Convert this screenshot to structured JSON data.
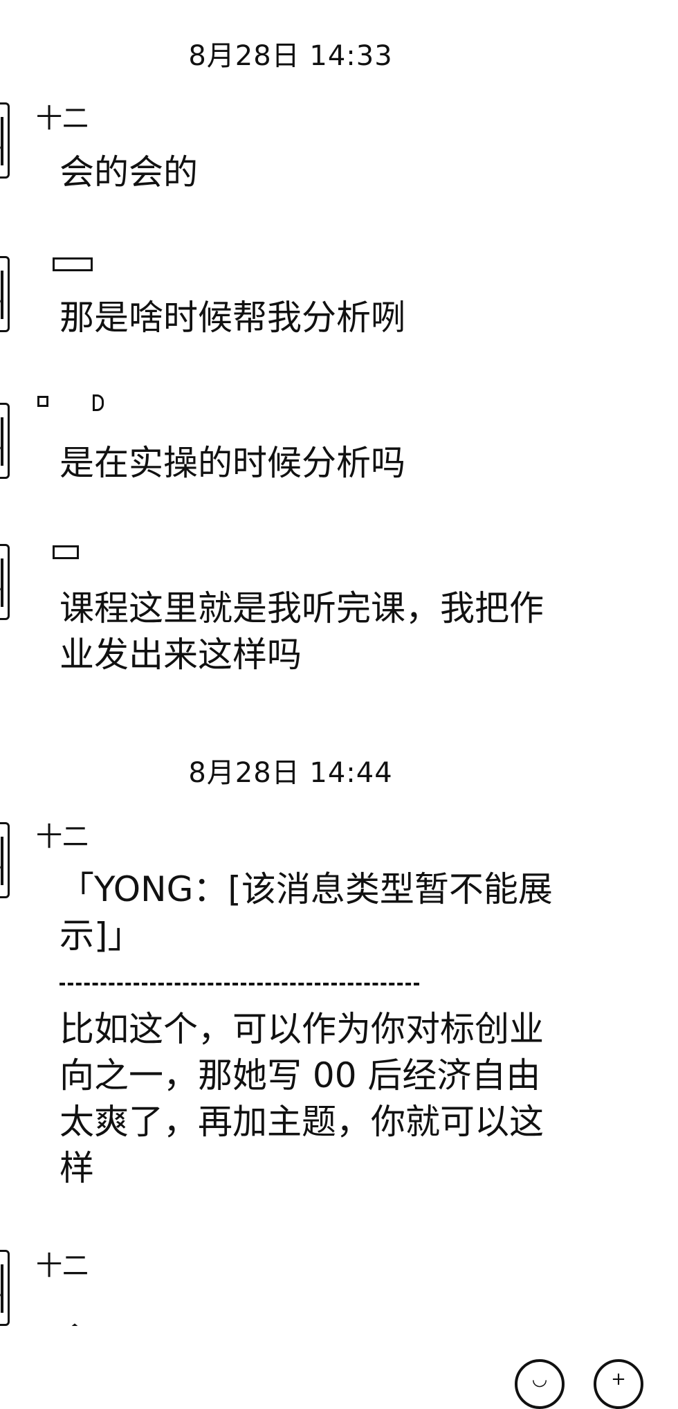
{
  "timestamps": [
    "8月28日 14:33",
    "8月28日 14:44"
  ],
  "messages": [
    {
      "sender": "十二",
      "text": "会的会的"
    },
    {
      "sender": "",
      "text": "那是啥时候帮我分析咧"
    },
    {
      "sender": "",
      "text": "是在实操的时候分析吗"
    },
    {
      "sender": "",
      "text": "课程这里就是我听完课，我把作业发出来这样吗"
    },
    {
      "sender": "十二",
      "quote": "「YONG：[该消息类型暂不能展示]」",
      "text": "比如这个，可以作为你对标创业向之一，那她写 00 后经济自由太爽了，再加主题，你就可以这样"
    },
    {
      "sender": "十二",
      "text": ""
    }
  ],
  "toolbar": {
    "voice_icon": "voice-icon",
    "emoji_icon": "emoji-icon",
    "add_icon": "add-icon"
  }
}
